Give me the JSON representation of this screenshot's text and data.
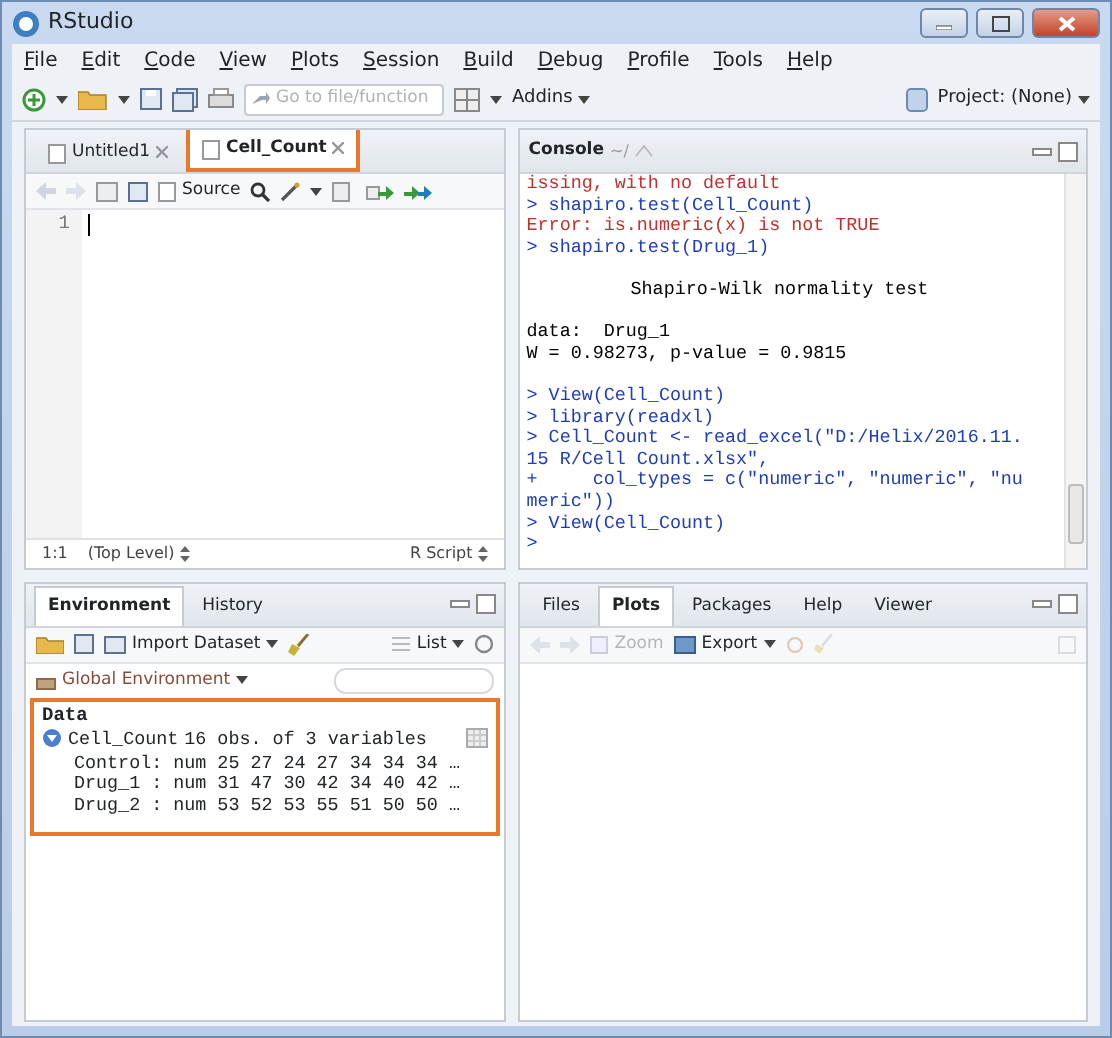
{
  "window": {
    "title": "RStudio"
  },
  "menu": [
    "File",
    "Edit",
    "Code",
    "View",
    "Plots",
    "Session",
    "Build",
    "Debug",
    "Profile",
    "Tools",
    "Help"
  ],
  "toolbar": {
    "search_placeholder": "Go to file/function",
    "addins": "Addins",
    "project": "Project: (None)"
  },
  "editor": {
    "tabs": [
      {
        "label": "Untitled1",
        "selected": false,
        "highlighted": false
      },
      {
        "label": "Cell_Count",
        "selected": true,
        "highlighted": true
      }
    ],
    "source_button": "Source",
    "line_numbers": [
      "1"
    ],
    "status": {
      "position": "1:1",
      "scope": "(Top Level)",
      "file_type": "R Script"
    }
  },
  "console": {
    "title": "Console",
    "path": "~/",
    "lines": [
      {
        "kind": "error",
        "text": "issing, with no default"
      },
      {
        "kind": "input",
        "text": "> shapiro.test(Cell_Count)"
      },
      {
        "kind": "error",
        "text": "Error: is.numeric(x) is not TRUE"
      },
      {
        "kind": "input",
        "text": "> shapiro.test(Drug_1)"
      },
      {
        "kind": "blank"
      },
      {
        "kind": "heading",
        "text": "Shapiro-Wilk normality test"
      },
      {
        "kind": "blank"
      },
      {
        "kind": "output",
        "text": "data:  Drug_1"
      },
      {
        "kind": "output",
        "text": "W = 0.98273, p-value = 0.9815"
      },
      {
        "kind": "blank"
      },
      {
        "kind": "input",
        "text": "> View(Cell_Count)"
      },
      {
        "kind": "input",
        "text": "> library(readxl)"
      },
      {
        "kind": "input",
        "text": "> Cell_Count <- read_excel(\"D:/Helix/2016.11."
      },
      {
        "kind": "input",
        "text": "15 R/Cell Count.xlsx\","
      },
      {
        "kind": "input",
        "text": "+     col_types = c(\"numeric\", \"numeric\", \"nu"
      },
      {
        "kind": "input",
        "text": "meric\"))"
      },
      {
        "kind": "input",
        "text": "> View(Cell_Count)"
      },
      {
        "kind": "input",
        "text": ">"
      }
    ]
  },
  "environment": {
    "tabs": [
      {
        "label": "Environment",
        "selected": true
      },
      {
        "label": "History",
        "selected": false
      }
    ],
    "import_button": "Import Dataset",
    "view_mode": "List",
    "scope": "Global Environment",
    "highlighted": true,
    "section": "Data",
    "objects": [
      {
        "name": "Cell_Count",
        "summary": "16 obs. of 3 variables",
        "expanded": true,
        "columns": [
          "Control: num 25 27 24 27 34 34 34 …",
          "Drug_1 : num 31 47 30 42 34 40 42 …",
          "Drug_2 : num 53 52 53 55 51 50 50 …"
        ]
      }
    ]
  },
  "files": {
    "tabs": [
      {
        "label": "Files",
        "selected": false
      },
      {
        "label": "Plots",
        "selected": true
      },
      {
        "label": "Packages",
        "selected": false
      },
      {
        "label": "Help",
        "selected": false
      },
      {
        "label": "Viewer",
        "selected": false
      }
    ],
    "zoom_button": "Zoom",
    "export_button": "Export"
  }
}
